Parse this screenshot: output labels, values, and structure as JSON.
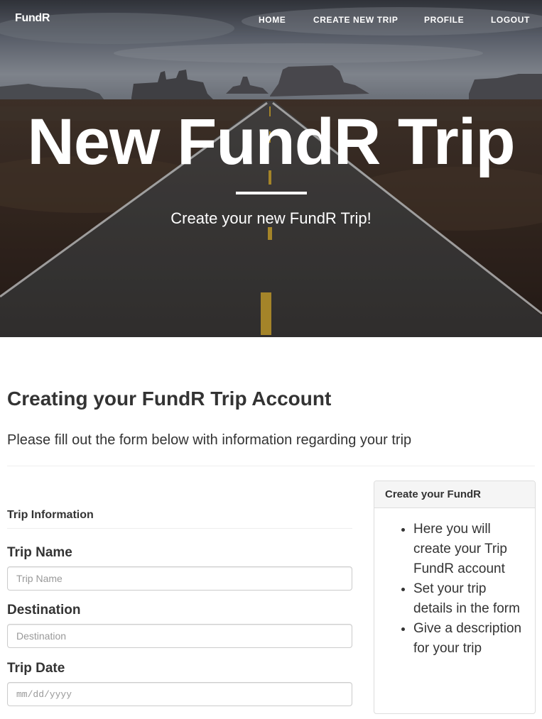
{
  "nav": {
    "brand": "FundR",
    "links": [
      "HOME",
      "CREATE NEW TRIP",
      "PROFILE",
      "LOGOUT"
    ]
  },
  "hero": {
    "title": "New FundR Trip",
    "subtitle": "Create your new FundR Trip!"
  },
  "main": {
    "heading": "Creating your FundR Trip Account",
    "lead": "Please fill out the form below with information regarding your trip"
  },
  "form": {
    "section_title": "Trip Information",
    "fields": [
      {
        "label": "Trip Name",
        "placeholder": "Trip Name",
        "value": ""
      },
      {
        "label": "Destination",
        "placeholder": "Destination",
        "value": ""
      },
      {
        "label": "Trip Date",
        "placeholder": "mm/dd/yyyy",
        "value": ""
      }
    ]
  },
  "panel": {
    "heading": "Create your FundR",
    "items": [
      "Here you will create your Trip FundR account",
      "Set your trip details in the form",
      "Give a description for your trip"
    ]
  },
  "colors": {
    "text": "#333333",
    "panel_heading_bg": "#f5f5f5",
    "border": "#cccccc",
    "hero_text": "#ffffff"
  },
  "icons": [
    "hero-road-image"
  ]
}
